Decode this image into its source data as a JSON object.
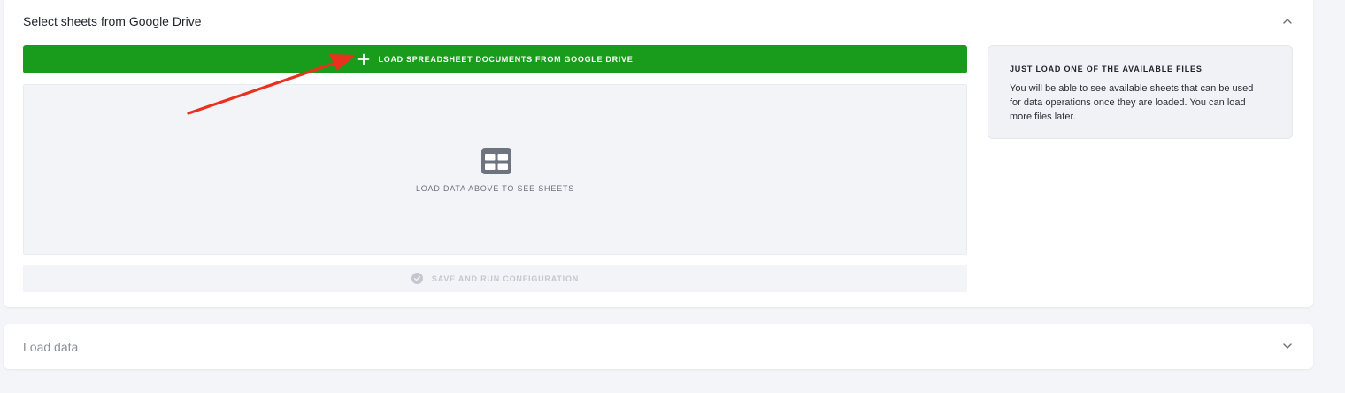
{
  "sections": {
    "sheets": {
      "title": "Select sheets from Google Drive",
      "toggle_icon": "chevron-up-icon"
    },
    "load": {
      "title": "Load data",
      "toggle_icon": "chevron-down-icon"
    }
  },
  "load_button": {
    "icon": "plus-icon",
    "label": "LOAD SPREADSHEET DOCUMENTS FROM GOOGLE DRIVE",
    "color": "#199b1b"
  },
  "sheets_area": {
    "icon": "table-icon",
    "empty_text": "LOAD DATA ABOVE TO SEE SHEETS"
  },
  "save_button": {
    "icon": "check-circle-icon",
    "label": "SAVE AND RUN CONFIGURATION",
    "disabled": true
  },
  "info_box": {
    "title": "JUST LOAD ONE OF THE AVAILABLE FILES",
    "body": "You will be able to see available sheets that can be used for data operations once they are loaded. You can load more files later."
  },
  "annotation": {
    "icon": "red-arrow-annotation",
    "color": "#e8321e"
  }
}
